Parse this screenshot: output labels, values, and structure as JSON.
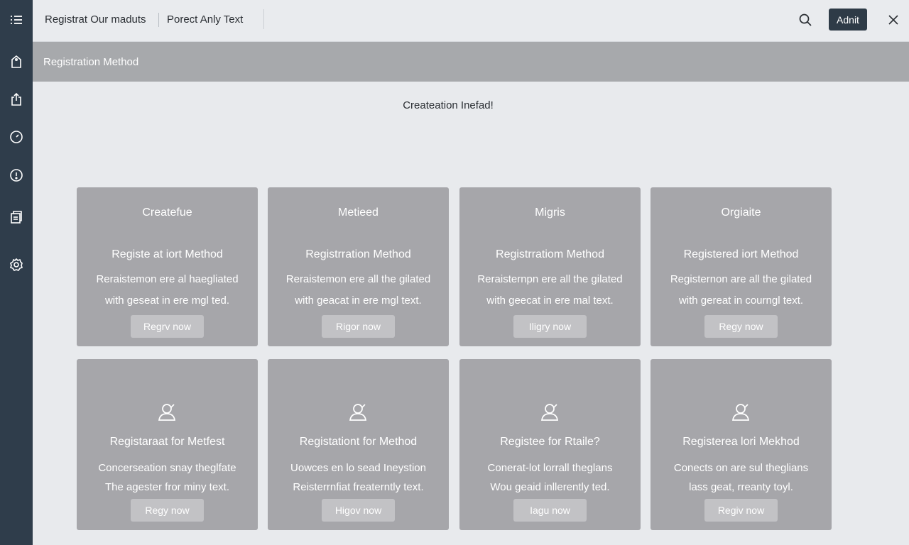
{
  "header": {
    "title": "Registrat Our maduts",
    "subtitle": "Porect Anly Text",
    "admin_label": "Adnit"
  },
  "sidebar": {
    "items": [
      {
        "icon": "tag-icon"
      },
      {
        "icon": "export-icon"
      },
      {
        "icon": "gauge-icon"
      },
      {
        "icon": "info-icon"
      },
      {
        "icon": "documents-icon"
      },
      {
        "icon": "settings-icon"
      }
    ]
  },
  "section": {
    "title": "Registration Method"
  },
  "main": {
    "heading": "Createation Inefad!"
  },
  "cards_row1": [
    {
      "top": "Createfue",
      "title": "Registe at iort Method",
      "line1": "Reraistemon ere al haegliated",
      "line2": "with geseat in ere mgl ted.",
      "button": "Regrv now"
    },
    {
      "top": "Metieed",
      "title": "Registrration Method",
      "line1": "Reraistemon ere all the gilated",
      "line2": "with geacat in ere mgl text.",
      "button": "Rigor now"
    },
    {
      "top": "Migris",
      "title": "Registrratiom Method",
      "line1": "Reraisternpn ere all the gilated",
      "line2": "with geecat in ere mal text.",
      "button": "Iligry now"
    },
    {
      "top": "Orgiaite",
      "title": "Registered iort Method",
      "line1": "Registernon are all the gilated",
      "line2": "with gereat in courngl text.",
      "button": "Regy now"
    }
  ],
  "cards_row2": [
    {
      "title": "Registaraat for Metfest",
      "line1": "Concerseation snay theglfate",
      "line2": "The agester fror miny text.",
      "button": "Regy now",
      "icon": "user-icon"
    },
    {
      "title": "Registationt for Method",
      "line1": "Uowces en lo sead Ineystion",
      "line2": "Reisterrnfiat freaterntly text.",
      "button": "Higov now",
      "icon": "user-icon"
    },
    {
      "title": "Registee for Rtaile?",
      "line1": "Conerat-lot lorrall theglans",
      "line2": "Wou geaid inllerently ted.",
      "button": "Iagu now",
      "icon": "user-icon"
    },
    {
      "title": "Registerea lori Mekhod",
      "line1": "Conects on are sul theglians",
      "line2": "lass geat, rreanty toyl.",
      "button": "Regiv now",
      "icon": "user-icon"
    }
  ]
}
